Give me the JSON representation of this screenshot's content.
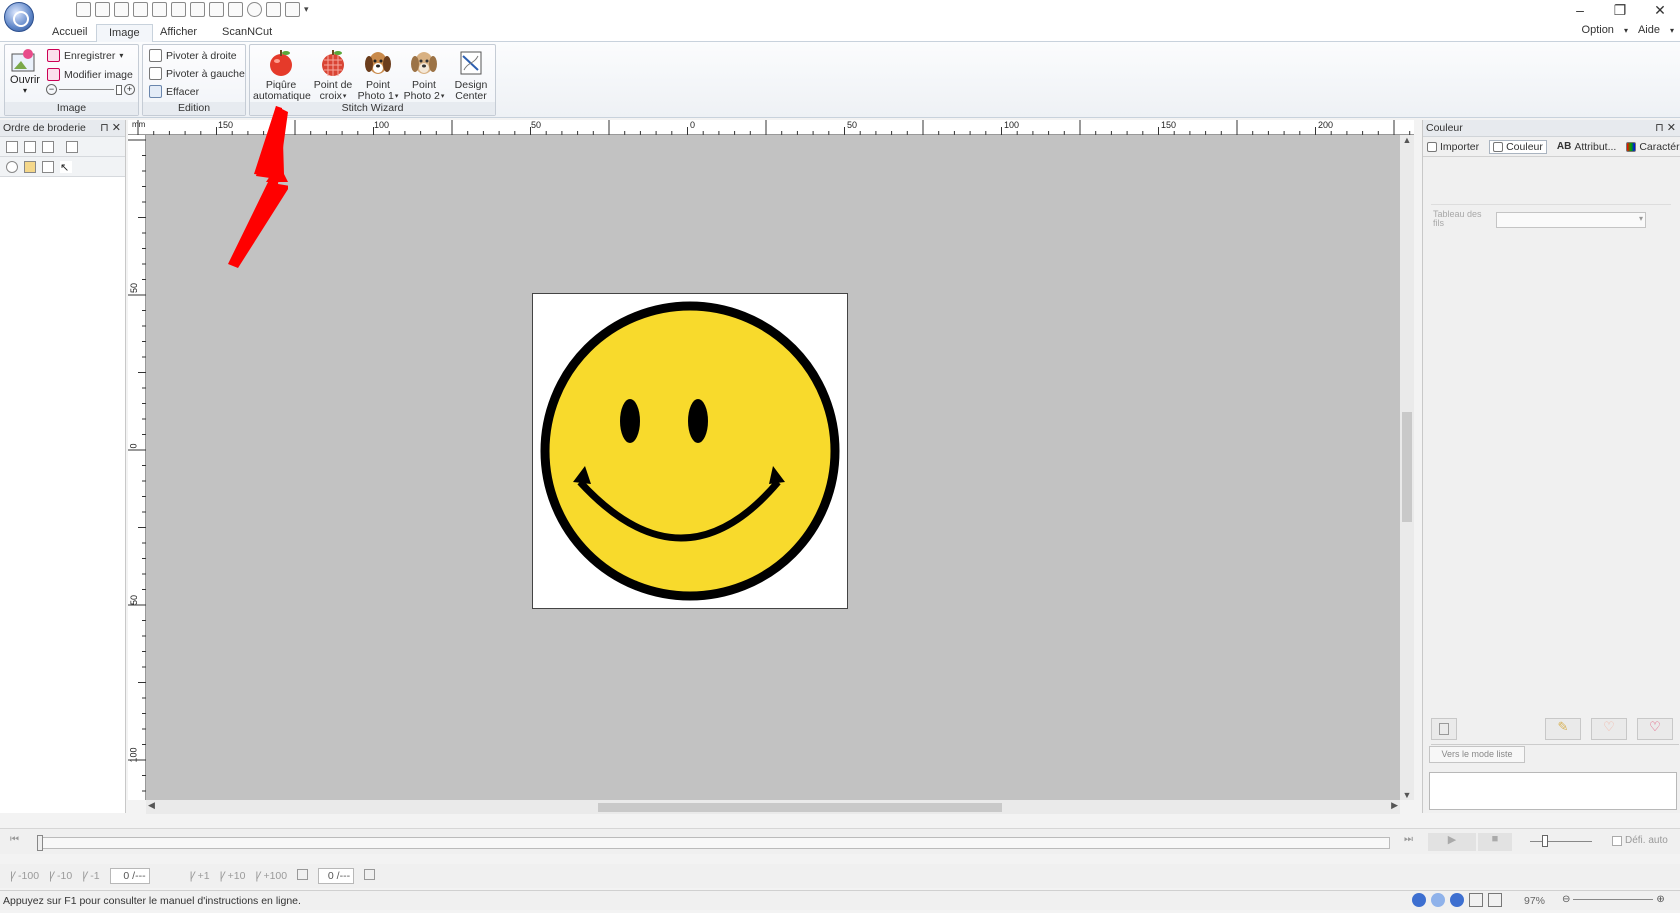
{
  "window": {
    "minimize": "–",
    "restore": "❐",
    "close": "✕"
  },
  "tabs": [
    "Accueil",
    "Image",
    "Afficher",
    "ScanNCut"
  ],
  "right_menu": {
    "option": "Option",
    "aide": "Aide"
  },
  "ribbon": {
    "group_image": {
      "label": "Image",
      "ouvrir": "Ouvrir",
      "enregistrer": "Enregistrer",
      "modifier": "Modifier image"
    },
    "group_edition": {
      "label": "Edition",
      "pivoter_droite": "Pivoter à droite",
      "pivoter_gauche": "Pivoter à gauche",
      "effacer": "Effacer"
    },
    "group_stitch": {
      "label": "Stitch Wizard",
      "piqure": [
        "Piqûre",
        "automatique"
      ],
      "point_croix": [
        "Point de",
        "croix"
      ],
      "photo1": [
        "Point",
        "Photo 1"
      ],
      "photo2": [
        "Point",
        "Photo 2"
      ],
      "design": [
        "Design",
        "Center"
      ]
    }
  },
  "left_panel": {
    "title": "Ordre de broderie"
  },
  "ruler_h_labels": [
    "150",
    "100",
    "50",
    "0",
    "50",
    "100",
    "150",
    "200"
  ],
  "ruler_v_labels": [
    "50",
    "0",
    "50",
    "100"
  ],
  "ruler_unit": "mm",
  "right_panel": {
    "title": "Couleur",
    "tabs": [
      "Importer",
      "Couleur",
      "Attribut...",
      "Caractér..."
    ],
    "tableau_label": "Tableau des fils",
    "list_mode_button": "Vers le mode liste"
  },
  "timeline": {
    "auto_label": "Défi. auto"
  },
  "stepbar": {
    "buttons_left": [
      "-100",
      "-10",
      "-1"
    ],
    "value1": "0 /---",
    "buttons_right": [
      "+1",
      "+10",
      "+100"
    ],
    "value2": "0 /---"
  },
  "status": {
    "message": "Appuyez sur F1 pour consulter le manuel d'instructions en ligne.",
    "zoom": "97%"
  },
  "colors": {
    "smiley_yellow": "#f8da2c",
    "arrow_red": "#ff0000",
    "canvas_gray": "#c2c2c2"
  }
}
